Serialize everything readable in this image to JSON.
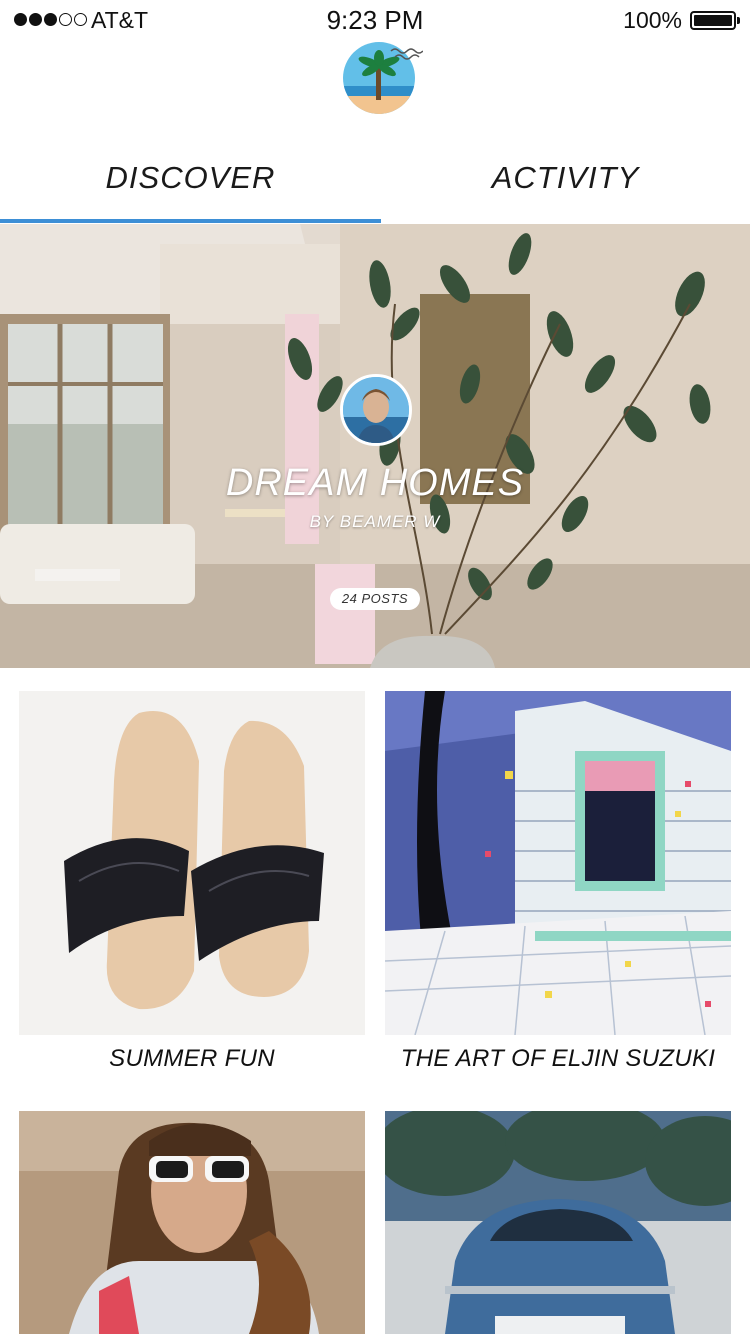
{
  "status_bar": {
    "carrier": "AT&T",
    "time": "9:23 PM",
    "battery_percent": "100%",
    "signal_bars": 3,
    "signal_total": 5
  },
  "logo": {
    "icon": "palm-beach-logo-icon"
  },
  "tabs": [
    {
      "label": "DISCOVER",
      "active": true
    },
    {
      "label": "ACTIVITY",
      "active": false
    }
  ],
  "accent_color": "#3d8fd6",
  "featured": {
    "title": "DREAM HOMES",
    "author": "BY BEAMER W",
    "posts": "24 POSTS",
    "image": "living-room-with-plant-photo",
    "avatar": "user-avatar-photo"
  },
  "collections": [
    {
      "title": "SUMMER FUN",
      "image": "leather-sandals-photo"
    },
    {
      "title": "THE ART OF ELJIN SUZUKI",
      "image": "retro-illustration-art"
    },
    {
      "title": "",
      "image": "woman-with-sunglasses-photo"
    },
    {
      "title": "",
      "image": "vintage-blue-car-photo"
    }
  ]
}
